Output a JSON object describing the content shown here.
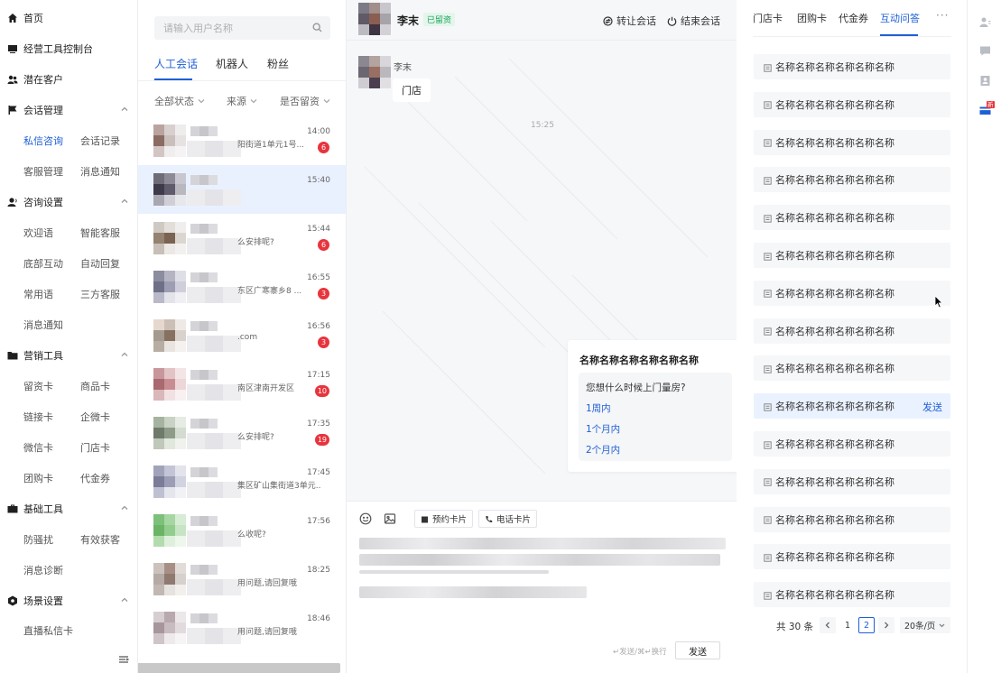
{
  "nav": {
    "home": "首页",
    "console": "经营工具控制台",
    "leads": "潜在客户",
    "session_mgmt": "会话管理",
    "session_subs": [
      "私信咨询",
      "会话记录",
      "客服管理",
      "消息通知"
    ],
    "consult_settings": "咨询设置",
    "consult_subs": [
      "欢迎语",
      "智能客服",
      "底部互动",
      "自动回复",
      "常用语",
      "三方客服",
      "消息通知"
    ],
    "marketing": "营销工具",
    "marketing_subs": [
      "留资卡",
      "商品卡",
      "链接卡",
      "企微卡",
      "微信卡",
      "门店卡",
      "团购卡",
      "代金券"
    ],
    "basic": "基础工具",
    "basic_subs": [
      "防骚扰",
      "有效获客",
      "消息诊断"
    ],
    "scene": "场景设置",
    "scene_subs": [
      "直播私信卡"
    ]
  },
  "conv_list": {
    "search_placeholder": "请输入用户名称",
    "tabs": [
      "人工会话",
      "机器人",
      "粉丝"
    ],
    "filters": [
      "全部状态",
      "来源",
      "是否留资"
    ],
    "items": [
      {
        "time": "14:00",
        "preview": "阳街道1单元1号...",
        "badge": "6"
      },
      {
        "time": "15:40",
        "preview": "",
        "badge": ""
      },
      {
        "time": "15:44",
        "preview": "么安排呢?",
        "badge": "6"
      },
      {
        "time": "16:55",
        "preview": "东区广寒寨乡8 ...",
        "badge": "3"
      },
      {
        "time": "16:56",
        "preview": ".com",
        "badge": "3"
      },
      {
        "time": "17:15",
        "preview": "南区津南开发区",
        "badge": "10"
      },
      {
        "time": "17:35",
        "preview": "么安排呢?",
        "badge": "19"
      },
      {
        "time": "17:45",
        "preview": "集区矿山集街道3单元...",
        "badge": ""
      },
      {
        "time": "17:56",
        "preview": "么收呢?",
        "badge": ""
      },
      {
        "time": "18:25",
        "preview": "用问题,请回复哦",
        "badge": ""
      },
      {
        "time": "18:46",
        "preview": "用问题,请回复哦",
        "badge": ""
      }
    ]
  },
  "chat": {
    "name": "李末",
    "tag": "已留资",
    "transfer": "转让会话",
    "end": "结束会话",
    "msg_name": "李末",
    "msg_text": "门店",
    "time_sep": "15:25",
    "card": {
      "title": "名称名称名称名称名称名称",
      "question": "您想什么时候上门量房?",
      "options": [
        "1周内",
        "1个月内",
        "2个月内"
      ]
    },
    "tools": {
      "booking_card": "预约卡片",
      "phone_card": "电话卡片"
    },
    "hint": "↵发送/⌘↵换行",
    "send": "发送"
  },
  "right": {
    "tabs": [
      "门店卡",
      "团购卡",
      "代金券",
      "互动问答"
    ],
    "more": "···",
    "item_label": "名称名称名称名称名称名称",
    "item_count": 15,
    "hover_index": 9,
    "send": "发送",
    "pager": {
      "total": "共 30 条",
      "pages": [
        "1",
        "2"
      ],
      "current": "2",
      "size": "20条/页"
    }
  },
  "rail": {
    "new_badge": "新"
  },
  "colors": {
    "accent": "#1f5fd6",
    "badge": "#e8343c",
    "tag_green": "#1aa058"
  }
}
